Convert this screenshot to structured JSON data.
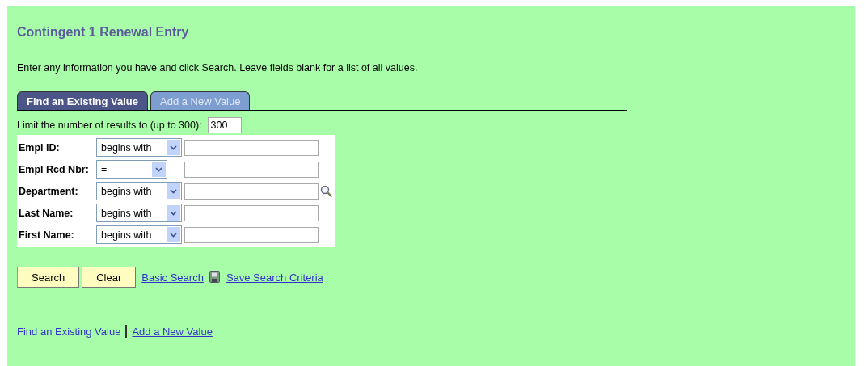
{
  "title": "Contingent 1 Renewal Entry",
  "instructions": "Enter any information you have and click Search. Leave fields blank for a list of all values.",
  "tabs": [
    {
      "label": "Find an Existing Value",
      "selected": true
    },
    {
      "label": "Add a New Value",
      "selected": false
    }
  ],
  "limit": {
    "label": "Limit the number of results to (up to 300):",
    "value": "300"
  },
  "criteria": [
    {
      "label": "Empl ID:",
      "operator": "begins with",
      "lookup": false
    },
    {
      "label": "Empl Rcd Nbr:",
      "operator": "=",
      "lookup": false
    },
    {
      "label": "Department:",
      "operator": "begins with",
      "lookup": true
    },
    {
      "label": "Last Name:",
      "operator": "begins with",
      "lookup": false
    },
    {
      "label": "First Name:",
      "operator": "begins with",
      "lookup": false
    }
  ],
  "buttons": [
    "Search",
    "Clear"
  ],
  "links": [
    {
      "label": "Basic Search",
      "kind": "plain"
    },
    {
      "label": "Save Search Criteria",
      "kind": "save"
    }
  ],
  "footer_links": [
    {
      "label": "Find an Existing Value",
      "selected": true
    },
    {
      "label": "Add a New Value",
      "selected": false
    }
  ]
}
